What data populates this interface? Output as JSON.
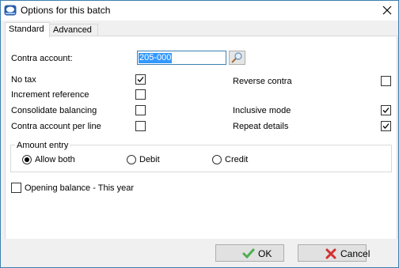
{
  "window": {
    "title": "Options for this batch"
  },
  "tabs": [
    {
      "label": "Standard",
      "active": true
    },
    {
      "label": "Advanced",
      "active": false
    }
  ],
  "contra": {
    "label": "Contra account:",
    "value": "205-000"
  },
  "options": {
    "no_tax": {
      "label": "No tax",
      "checked": true
    },
    "increment_reference": {
      "label": "Increment reference",
      "checked": false
    },
    "consolidate_balancing": {
      "label": "Consolidate balancing",
      "checked": false
    },
    "contra_per_line": {
      "label": "Contra account per line",
      "checked": false
    },
    "reverse_contra": {
      "label": "Reverse contra",
      "checked": false
    },
    "inclusive_mode": {
      "label": "Inclusive mode",
      "checked": true
    },
    "repeat_details": {
      "label": "Repeat details",
      "checked": true
    },
    "opening_balance": {
      "label": "Opening balance - This year",
      "checked": false
    }
  },
  "amount_entry": {
    "title": "Amount entry",
    "options": [
      {
        "label": "Allow both",
        "selected": true
      },
      {
        "label": "Debit",
        "selected": false
      },
      {
        "label": "Credit",
        "selected": false
      }
    ]
  },
  "buttons": {
    "ok": "OK",
    "cancel": "Cancel"
  },
  "colors": {
    "accent": "#3c7fb1",
    "selection": "#3399ff",
    "ok_icon": "#4caf50",
    "cancel_icon": "#d32f2f"
  }
}
